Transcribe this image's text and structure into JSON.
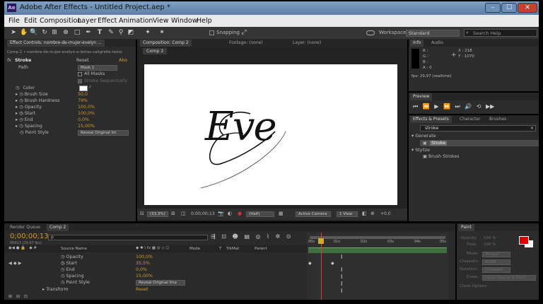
{
  "app": {
    "title": "Adobe After Effects - Untitled Project.aep *",
    "icon_text": "Ae"
  },
  "window_buttons": [
    "–",
    "☐",
    "✕"
  ],
  "menu": [
    "File",
    "Edit",
    "Composition",
    "Layer",
    "Effect",
    "Animation",
    "View",
    "Window",
    "Help"
  ],
  "toolbar": {
    "snapping_label": "Snapping",
    "workspace_label": "Workspace:",
    "workspace_value": "Standard",
    "search_placeholder": "Search Help"
  },
  "effect_controls": {
    "tab_label": "Effect Controls: nombre-de-mujer-evelyn ...",
    "breadcrumb": "Comp 2 • nombre-de-mujer-evelyn-o-letras-caligrafia-texto",
    "effect_name": "Stroke",
    "reset_label": "Reset",
    "about_label": "Abo",
    "path_label": "Path",
    "path_value": "Mask 1",
    "all_masks_label": "All Masks",
    "stroke_seq_label": "Stroke Sequentially",
    "params": [
      {
        "label": "Color",
        "value": ""
      },
      {
        "label": "Brush Size",
        "value": "50,0"
      },
      {
        "label": "Brush Hardness",
        "value": "79%"
      },
      {
        "label": "Opacity",
        "value": "100,0%"
      },
      {
        "label": "Start",
        "value": "100,0%"
      },
      {
        "label": "End",
        "value": "0,0%"
      },
      {
        "label": "Spacing",
        "value": "15,00%"
      },
      {
        "label": "Paint Style",
        "value": "Reveal Original Im"
      }
    ],
    "stroke_color": "#ffffff"
  },
  "composition": {
    "tabs": [
      "Composition: Comp 2",
      "Footage: (none)",
      "Layer: (none)"
    ],
    "subtab": "Comp 2",
    "canvas_text": "Eve",
    "footer": {
      "zoom": "(33,3%)",
      "timecode": "0;00;00;13",
      "resolution": "(Half)",
      "camera": "Active Camera",
      "views": "1 View",
      "offset": "+0,0"
    }
  },
  "info": {
    "tabs": [
      "Info",
      "Audio"
    ],
    "r": "R :",
    "g": "G :",
    "b": "B :",
    "a": "A : 0",
    "x": "X : 218",
    "y": "Y : 1070",
    "fps": "fps: 29,97 (realtime)"
  },
  "preview": {
    "tab": "Preview"
  },
  "effects_presets": {
    "tabs": [
      "Effects & Presets",
      "Character",
      "Brushes"
    ],
    "search_value": "stroke",
    "groups": [
      {
        "name": "Generate",
        "items": [
          "Stroke"
        ]
      },
      {
        "name": "Stylize",
        "items": [
          "Brush Strokes"
        ]
      }
    ]
  },
  "timeline": {
    "tabs": [
      "Render Queue",
      "Comp 2"
    ],
    "timecode": "0;00;00;13",
    "fps_text": "00013 (29.97 fps)",
    "search_value": "ρ",
    "headers": {
      "source_name": "Source Name",
      "mode": "Mode",
      "t": "T",
      "trkmat": "TrkMat",
      "parent": "Parent"
    },
    "layers": [
      {
        "label": "Opacity",
        "value": "100,0%"
      },
      {
        "label": "Start",
        "value": "35,5%"
      },
      {
        "label": "End",
        "value": "0,0%"
      },
      {
        "label": "Spacing",
        "value": "15,00%"
      },
      {
        "label": "Paint Style",
        "value": "Reveal Original Ima"
      },
      {
        "label": "Transform",
        "value": "Reset"
      }
    ],
    "ruler": [
      "00s",
      "01s",
      "02s",
      "03s",
      "04s",
      "05s"
    ]
  },
  "paint": {
    "tab": "Paint",
    "fields": [
      {
        "label": "Opacity:",
        "value": "100 %"
      },
      {
        "label": "Flow:",
        "value": "100 %"
      },
      {
        "label": "Mode:",
        "value": "Normal"
      },
      {
        "label": "Channels:",
        "value": "RGBA"
      },
      {
        "label": "Duration:",
        "value": "Constant"
      },
      {
        "label": "Erase:",
        "value": "Layer Source & Paint"
      },
      {
        "label": "Clone Options",
        "value": ""
      }
    ],
    "fg_color": "#e00000",
    "bg_color": "#ffffff"
  }
}
